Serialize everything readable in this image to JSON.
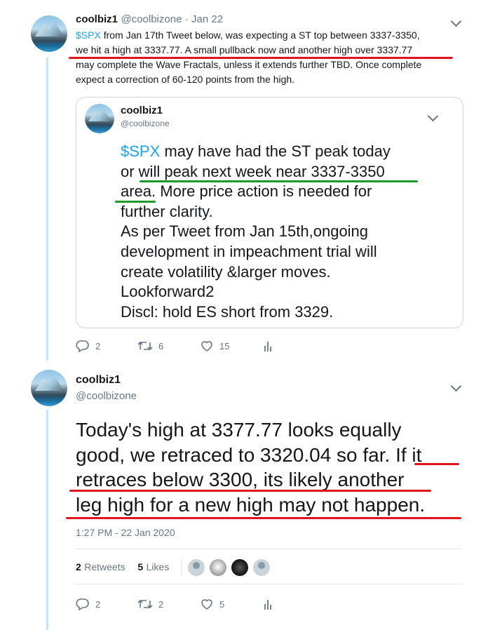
{
  "tweet1": {
    "name": "coolbiz1",
    "handle": "@coolbizone",
    "date": "· Jan 22",
    "line1_link": "$SPX",
    "line1_rest": " from Jan 17th Tweet below, was expecting a ST top between 3337-3350,",
    "line2": "we hit a high at 3337.77. A small pullback now and another high over 3337.77",
    "line3": "may complete the Wave Fractals, unless it extends further TBD. Once complete",
    "line4": "expect a correction of 60-120 points from the high.",
    "replies": "2",
    "retweets": "6",
    "likes": "15"
  },
  "quoted": {
    "name": "coolbiz1",
    "handle": "@coolbizone",
    "line1_link": "$SPX",
    "line1_rest": " may have had the ST peak today",
    "line2": "or will peak next week near 3337-3350",
    "line3": "area. More price action is needed for",
    "line4": "further clarity.",
    "line5": "As per Tweet from Jan 15th,ongoing",
    "line6": "development in impeachment trial will",
    "line7": "create volatility &larger moves.",
    "line8": "Lookforward2",
    "line9": "Discl: hold ES short from 3329."
  },
  "tweet2": {
    "name": "coolbiz1",
    "handle": "@coolbizone",
    "line1": "Today's high at 3377.77 looks equally",
    "line2": "good, we retraced to 3320.04 so far. If it",
    "line3": "retraces below 3300, its likely another",
    "line4": "leg high for a new high may not happen.",
    "timestamp": "1:27 PM - 22 Jan 2020",
    "retweet_count": "2",
    "retweet_label": "Retweets",
    "like_count": "5",
    "like_label": "Likes",
    "replies": "2",
    "retweets": "2",
    "likes": "5"
  },
  "colors": {
    "link": "#1da1f2",
    "underline_red": "#e0141e",
    "underline_green": "#1a9a2c"
  }
}
